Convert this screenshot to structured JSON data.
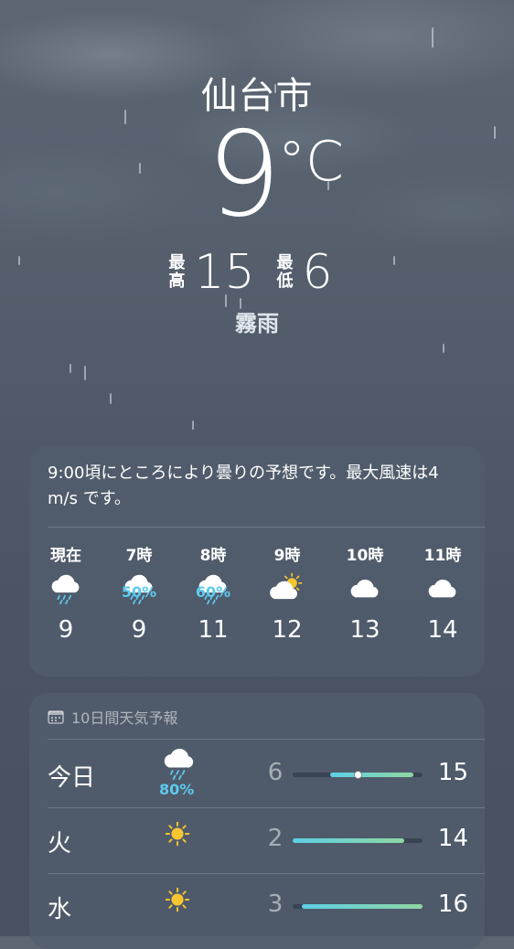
{
  "location": {
    "city": "仙台市",
    "current_temp": "9",
    "unit": "°C",
    "high_label": [
      "最",
      "高"
    ],
    "high": "15",
    "low_label": [
      "最",
      "低"
    ],
    "low": "6",
    "condition": "霧雨"
  },
  "hourly": {
    "summary": "9:00頃にところにより曇りの予想です。最大風速は4 m/s です。",
    "items": [
      {
        "time": "現在",
        "icon": "cloud-rain-icon",
        "precip": "",
        "temp": "9"
      },
      {
        "time": "7時",
        "icon": "cloud-rain-icon",
        "precip": "50%",
        "temp": "9"
      },
      {
        "time": "8時",
        "icon": "cloud-rain-icon",
        "precip": "60%",
        "temp": "11"
      },
      {
        "time": "9時",
        "icon": "partly-cloudy-icon",
        "precip": "",
        "temp": "12"
      },
      {
        "time": "10時",
        "icon": "cloud-icon",
        "precip": "",
        "temp": "13"
      },
      {
        "time": "11時",
        "icon": "cloud-icon",
        "precip": "",
        "temp": "14"
      }
    ]
  },
  "daily": {
    "header": "10日間天気予報",
    "header_icon": "calendar-icon",
    "range_min": 2,
    "range_max": 16,
    "items": [
      {
        "day": "今日",
        "icon": "cloud-rain-icon",
        "precip": "80%",
        "low": "6",
        "high": "15",
        "current": 9
      },
      {
        "day": "火",
        "icon": "sun-icon",
        "precip": "",
        "low": "2",
        "high": "14",
        "current": null
      },
      {
        "day": "水",
        "icon": "sun-icon",
        "precip": "",
        "low": "3",
        "high": "16",
        "current": null
      }
    ]
  },
  "colors": {
    "precip": "#5ccaf0",
    "sun": "#f7c531",
    "bar_start": "#5dd0e6",
    "bar_end": "#8fd7a2"
  }
}
